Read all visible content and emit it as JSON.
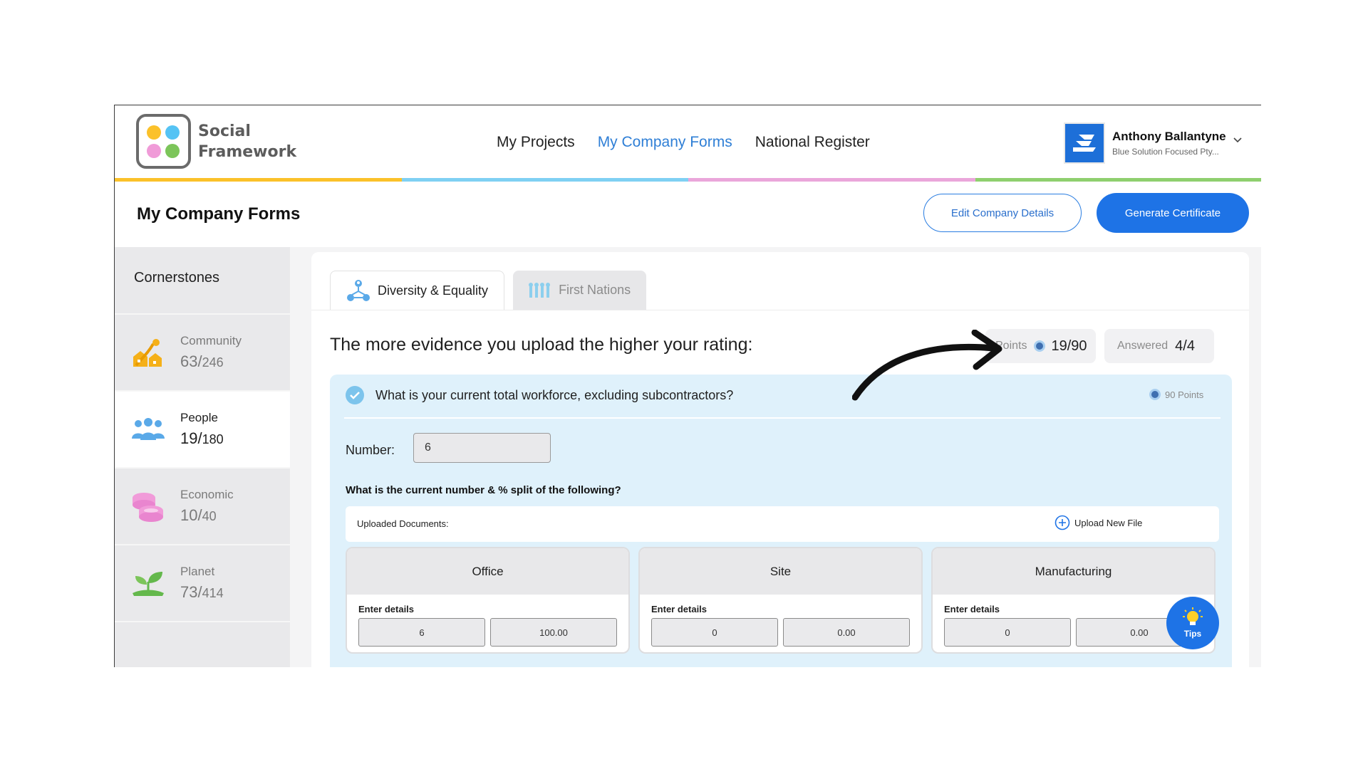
{
  "brand": {
    "line1": "Social",
    "line2": "Framework",
    "dot_colors": [
      "#fbc12a",
      "#55c3f4",
      "#f09bd8",
      "#7cc55a"
    ]
  },
  "nav": {
    "items": [
      {
        "label": "My Projects",
        "active": false
      },
      {
        "label": "My Company Forms",
        "active": true
      },
      {
        "label": "National Register",
        "active": false
      }
    ]
  },
  "user": {
    "name": "Anthony Ballantyne",
    "company": "Blue Solution Focused Pty...",
    "avatar_color": "#1d6fd8"
  },
  "stripe_colors": [
    "#fbc12a",
    "#7fd0f3",
    "#eaa6da",
    "#8fcf6e"
  ],
  "page": {
    "title": "My Company Forms",
    "edit_button": "Edit Company Details",
    "generate_button": "Generate Certificate"
  },
  "sidebar": {
    "heading": "Cornerstones",
    "items": [
      {
        "label": "Community",
        "score": "63/",
        "total": "246",
        "icon": "community-icon",
        "active": false
      },
      {
        "label": "People",
        "score": "19/",
        "total": "180",
        "icon": "people-icon",
        "active": true
      },
      {
        "label": "Economic",
        "score": "10/",
        "total": "40",
        "icon": "coins-icon",
        "active": false
      },
      {
        "label": "Planet",
        "score": "73/",
        "total": "414",
        "icon": "plant-icon",
        "active": false
      }
    ]
  },
  "tabs": [
    {
      "label": "Diversity & Equality",
      "icon": "diversity-icon",
      "active": true
    },
    {
      "label": "First Nations",
      "icon": "first-nations-icon",
      "active": false
    }
  ],
  "evidence_text": "The more evidence you upload the higher your rating:",
  "points_badge": {
    "label": "Points",
    "value": "19/90"
  },
  "answered_badge": {
    "label": "Answered",
    "value": "4/4"
  },
  "question": {
    "text": "What is your current total workforce, excluding subcontractors?",
    "points": "90 Points",
    "number_label": "Number:",
    "number_value": "6",
    "split_question": "What is the current number & % split of the following?",
    "uploaded_label": "Uploaded Documents:",
    "upload_button": "Upload New File",
    "categories": [
      {
        "name": "Office",
        "enter": "Enter details",
        "count": "6",
        "percent": "100.00"
      },
      {
        "name": "Site",
        "enter": "Enter details",
        "count": "0",
        "percent": "0.00"
      },
      {
        "name": "Manufacturing",
        "enter": "Enter details",
        "count": "0",
        "percent": "0.00"
      }
    ]
  },
  "tips_label": "Tips"
}
